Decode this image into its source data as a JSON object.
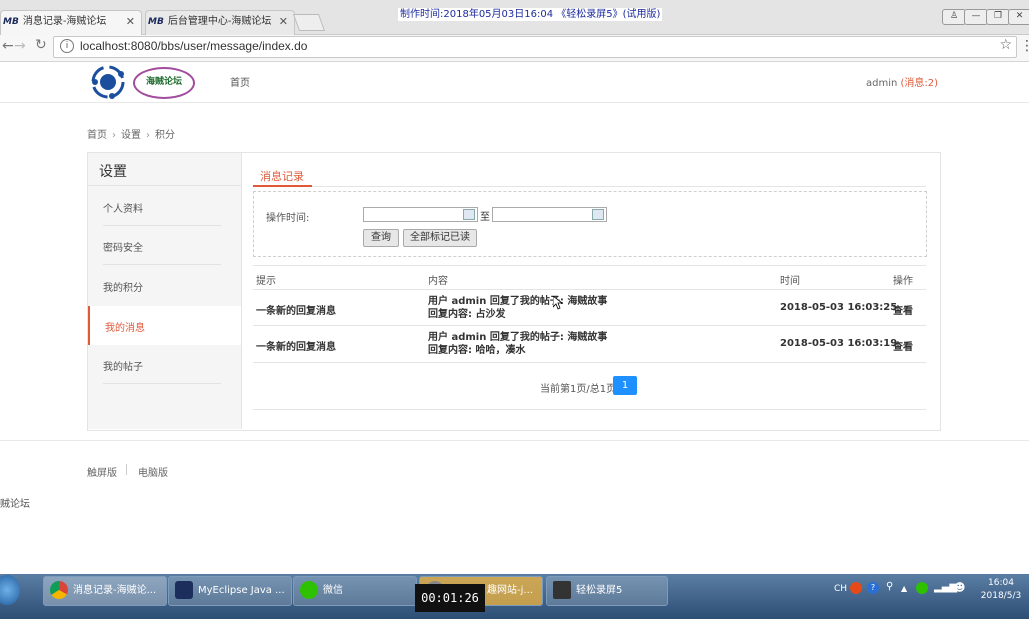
{
  "browser": {
    "tabs": [
      {
        "favicon": "MB",
        "title": "消息记录-海贼论坛"
      },
      {
        "favicon": "MB",
        "title": "后台管理中心-海贼论坛"
      }
    ],
    "watermark": "制作时间:2018年05月03日16:04 《轻松录屏5》(试用版)",
    "url": "localhost:8080/bbs/user/message/index.do"
  },
  "site": {
    "logo_text": "海贼论坛",
    "nav_home": "首页",
    "user": "admin",
    "messages_badge": "(消息:2)"
  },
  "breadcrumb": [
    "首页",
    "设置",
    "积分"
  ],
  "sidebar": {
    "title": "设置",
    "items": [
      {
        "label": "个人资料"
      },
      {
        "label": "密码安全"
      },
      {
        "label": "我的积分"
      },
      {
        "label": "我的消息",
        "active": true
      },
      {
        "label": "我的帖子"
      }
    ]
  },
  "main": {
    "tab_title": "消息记录",
    "filter": {
      "time_label": "操作时间:",
      "to_label": "至",
      "query_button": "查询",
      "mark_all_button": "全部标记已读"
    },
    "columns": [
      "提示",
      "内容",
      "时间",
      "操作"
    ],
    "rows": [
      {
        "tip": "一条新的回复消息",
        "content_line1": "用户 admin 回复了我的帖子: 海贼故事",
        "content_line2": "回复内容: 占沙发",
        "time": "2018-05-03 16:03:25",
        "action": "查看"
      },
      {
        "tip": "一条新的回复消息",
        "content_line1": "用户 admin 回复了我的帖子: 海贼故事",
        "content_line2": "回复内容: 哈哈，凑水",
        "time": "2018-05-03 16:03:19",
        "action": "查看"
      }
    ],
    "pagination": {
      "info": "当前第1页/总1页",
      "current": "1"
    }
  },
  "footer": {
    "touch": "触屏版",
    "pc": "电脑版",
    "site_name": "贼论坛"
  },
  "taskbar": {
    "tasks": [
      "消息记录-海贼论...",
      "MyEclipse Java ...",
      "微信",
      "趣网站-j...",
      "轻松录屏5"
    ],
    "timer": "00:01:26",
    "tray_lang": "CH",
    "time": "16:04",
    "date": "2018/5/3"
  },
  "colors": {
    "accent": "#e05a3a",
    "page_button": "#1e90ff",
    "taskbar": "#2e4e74"
  }
}
